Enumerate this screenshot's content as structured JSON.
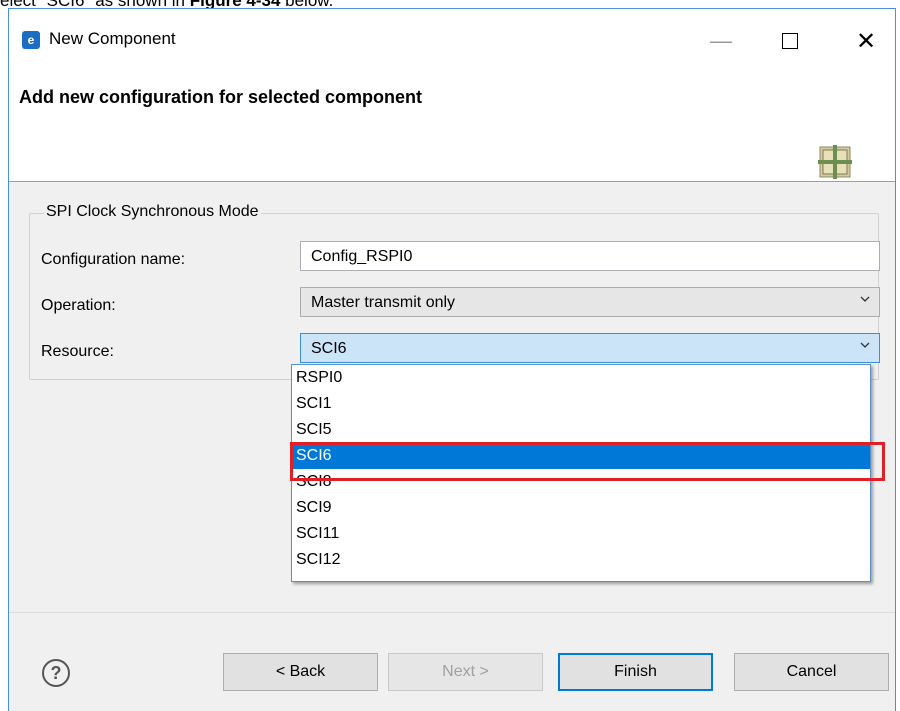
{
  "doc": {
    "pre": "elect \"SCI6\" as shown in ",
    "bold": "Figure 4-34",
    "post": " below."
  },
  "window": {
    "title": "New Component"
  },
  "header": {
    "title": "Add new configuration for selected component"
  },
  "group": {
    "legend": "SPI Clock Synchronous Mode"
  },
  "form": {
    "config_label": "Configuration name:",
    "config_value": "Config_RSPI0",
    "operation_label": "Operation:",
    "operation_value": "Master transmit only",
    "resource_label": "Resource:",
    "resource_value": "SCI6"
  },
  "dropdown": {
    "options": [
      "RSPI0",
      "SCI1",
      "SCI5",
      "SCI6",
      "SCI8",
      "SCI9",
      "SCI11",
      "SCI12"
    ],
    "selected_index": 3
  },
  "buttons": {
    "back": "< Back",
    "next": "Next >",
    "finish": "Finish",
    "cancel": "Cancel"
  },
  "colors": {
    "selection": "#0078d7",
    "highlight": "#e01f26",
    "accent": "#3c8fd6"
  },
  "icons": [
    "app-icon",
    "minimize-icon",
    "maximize-icon",
    "close-icon",
    "component-icon",
    "chevron-down-icon",
    "help-icon"
  ]
}
